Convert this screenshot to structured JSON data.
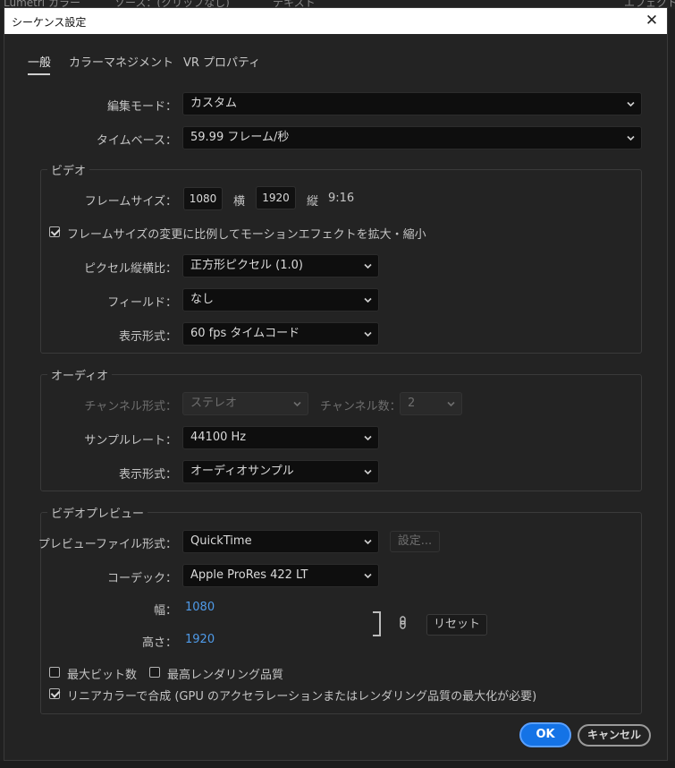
{
  "background": {
    "tabs": [
      "Lumetri カラー",
      "ソース：(クリップなし)",
      "テキスト",
      "エフェクト"
    ]
  },
  "dialog": {
    "title": "シーケンス設定",
    "close_glyph": "✕",
    "tabs": [
      "一般",
      "カラーマネジメント",
      "VR プロパティ"
    ],
    "active_tab": "一般"
  },
  "general": {
    "edit_mode_label": "編集モード：",
    "edit_mode_value": "カスタム",
    "timebase_label": "タイムベース：",
    "timebase_value": "59.99  フレーム/秒"
  },
  "video": {
    "group_title": "ビデオ",
    "frame_size_label": "フレームサイズ：",
    "frame_width": "1080",
    "horizontal_label": "横",
    "frame_height": "1920",
    "vertical_label": "縦",
    "aspect": "9:16",
    "scale_checkbox_label": "フレームサイズの変更に比例してモーションエフェクトを拡大・縮小",
    "scale_checked": true,
    "pixel_aspect_label": "ピクセル縦横比：",
    "pixel_aspect_value": "正方形ピクセル (1.0)",
    "fields_label": "フィールド：",
    "fields_value": "なし",
    "display_format_label": "表示形式：",
    "display_format_value": "60 fps タイムコード"
  },
  "audio": {
    "group_title": "オーディオ",
    "channel_format_label": "チャンネル形式：",
    "channel_format_value": "ステレオ",
    "channel_count_label": "チャンネル数：",
    "channel_count_value": "2",
    "sample_rate_label": "サンプルレート：",
    "sample_rate_value": "44100 Hz",
    "display_format_label": "表示形式：",
    "display_format_value": "オーディオサンプル"
  },
  "preview": {
    "group_title": "ビデオプレビュー",
    "file_format_label": "プレビューファイル形式：",
    "file_format_value": "QuickTime",
    "settings_button": "設定...",
    "codec_label": "コーデック：",
    "codec_value": "Apple ProRes 422 LT",
    "width_label": "幅：",
    "width_value": "1080",
    "height_label": "高さ：",
    "height_value": "1920",
    "reset_button": "リセット",
    "max_bit_depth_label": "最大ビット数",
    "max_bit_depth_checked": false,
    "max_render_quality_label": "最高レンダリング品質",
    "max_render_quality_checked": false,
    "linear_color_label": "リニアカラーで合成 (GPU のアクセラレーションまたはレンダリング品質の最大化が必要)",
    "linear_color_checked": true
  },
  "footer": {
    "ok_button": "OK",
    "cancel_button": "キャンセル"
  },
  "colors": {
    "accent": "#1473e6",
    "link_value": "#4f9be9",
    "dialog_bg": "#232323",
    "field_bg": "#0e0e0e"
  }
}
